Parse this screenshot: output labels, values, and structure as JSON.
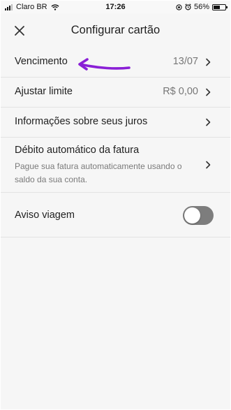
{
  "status_bar": {
    "carrier": "Claro BR",
    "time": "17:26",
    "battery_percent": "56%",
    "battery_level": 0.56
  },
  "header": {
    "title": "Configurar cartão",
    "close_icon": "close-icon"
  },
  "settings": {
    "due_date": {
      "label": "Vencimento",
      "value": "13/07"
    },
    "limit": {
      "label": "Ajustar limite",
      "value": "R$ 0,00"
    },
    "interest": {
      "label": "Informações sobre seus juros"
    },
    "autodebit": {
      "label": "Débito automático da fatura",
      "description": "Pague sua fatura automaticamente usando o saldo da sua conta."
    },
    "travel_notice": {
      "label": "Aviso viagem",
      "enabled": false
    }
  },
  "colors": {
    "background": "#f6f6f6",
    "toggle_off": "#7d7d7d",
    "annotation": "#8a1fd6"
  }
}
